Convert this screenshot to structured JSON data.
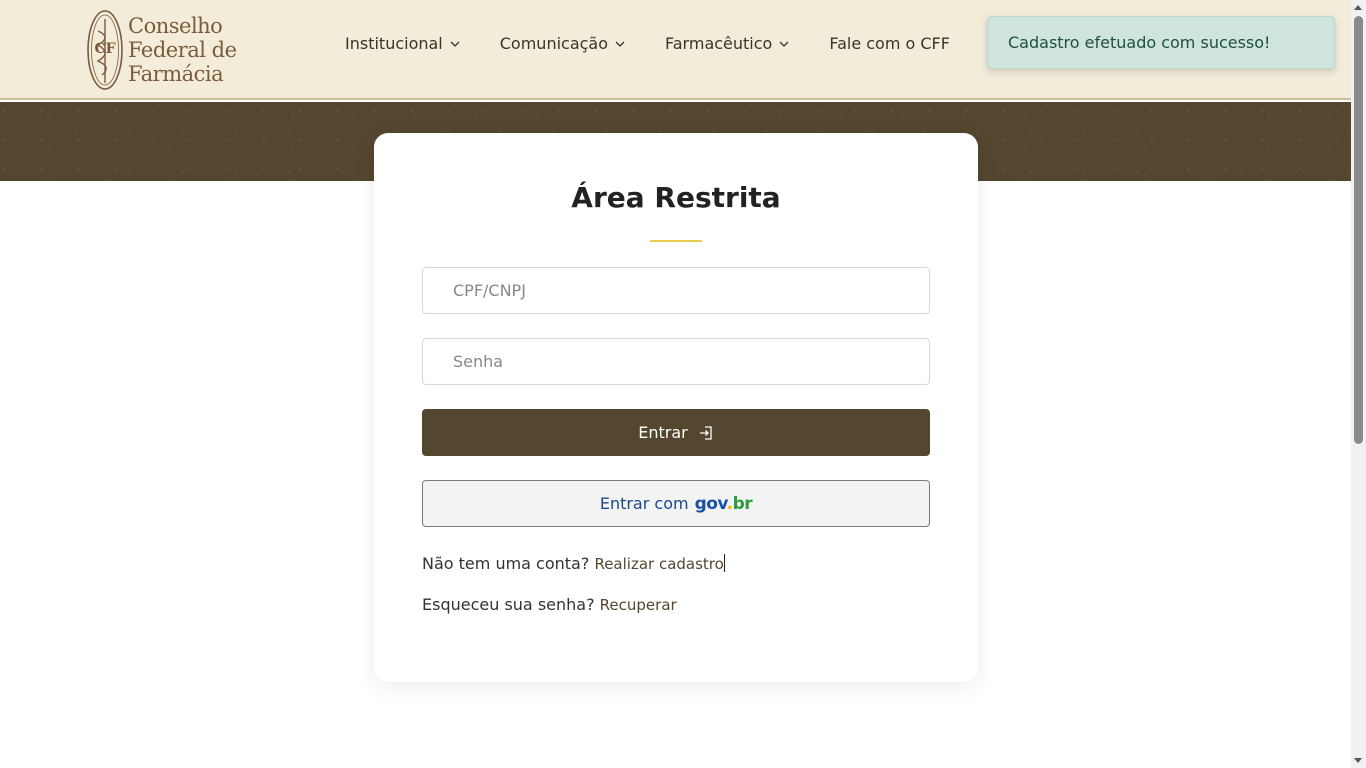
{
  "header": {
    "logo": {
      "line1": "Conselho",
      "line2": "Federal de",
      "line3": "Farmácia"
    },
    "nav": [
      {
        "label": "Institucional",
        "has_dropdown": true
      },
      {
        "label": "Comunicação",
        "has_dropdown": true
      },
      {
        "label": "Farmacêutico",
        "has_dropdown": true
      },
      {
        "label": "Fale com o CFF",
        "has_dropdown": false
      }
    ]
  },
  "toast": {
    "message": "Cadastro efetuado com sucesso!"
  },
  "login": {
    "title": "Área Restrita",
    "cpf_placeholder": "CPF/CNPJ",
    "senha_placeholder": "Senha",
    "entrar_label": "Entrar",
    "gov_prefix": "Entrar com",
    "gov_logo": {
      "part1": "gov",
      "part2": ".",
      "part3": "br"
    },
    "no_account_text": "Não tem uma conta?",
    "register_link": "Realizar cadastro",
    "forgot_text": "Esqueceu sua senha?",
    "recover_link": "Recuperar"
  },
  "colors": {
    "header_bg": "#f3ecd9",
    "brand_brown": "#54472f",
    "accent_gold": "#e7cb4c",
    "toast_bg": "#cfe4dc"
  },
  "icons": {
    "login": "login-icon",
    "chevron": "chevron-down-icon",
    "logo": "caduceus-emblem-icon"
  }
}
